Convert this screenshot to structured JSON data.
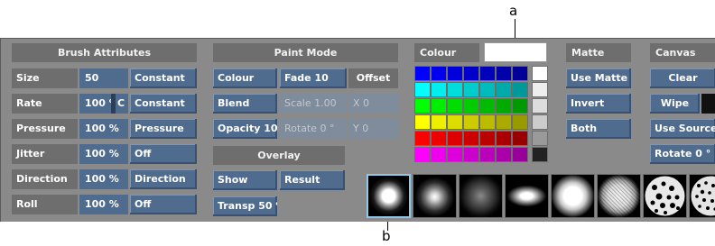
{
  "callouts": {
    "a": "a",
    "b": "b"
  },
  "brush_attributes": {
    "title": "Brush Attributes",
    "rows": [
      {
        "label": "Size",
        "value": "50",
        "mode": "Constant"
      },
      {
        "label": "Rate",
        "value": "100 %",
        "extra": "C",
        "mode": "Constant"
      },
      {
        "label": "Pressure",
        "value": "100 %",
        "mode": "Pressure"
      },
      {
        "label": "Jitter",
        "value": "100 %",
        "mode": "Off"
      },
      {
        "label": "Direction",
        "value": "100 %",
        "mode": "Direction"
      },
      {
        "label": "Roll",
        "value": "100 %",
        "mode": "Off"
      }
    ]
  },
  "paint_mode": {
    "title": "Paint Mode",
    "colour_button": "Colour",
    "fade": "Fade 10",
    "offset": "Offset",
    "blend": "Blend",
    "scale": "Scale 1.00",
    "x": "X 0",
    "opacity": "Opacity 100",
    "rotate": "Rotate 0 °",
    "y": "Y 0"
  },
  "overlay": {
    "title": "Overlay",
    "show": "Show",
    "result": "Result",
    "transp": "Transp 50 %"
  },
  "colour": {
    "title": "Colour",
    "current": "#ffffff",
    "palette": [
      [
        "#0000ff",
        "#0000ee",
        "#0000dd",
        "#0000cc",
        "#0000bb",
        "#0000aa",
        "#000099"
      ],
      [
        "#00ffff",
        "#00eeee",
        "#00dddd",
        "#00cccc",
        "#00bbbb",
        "#00aaaa",
        "#009999"
      ],
      [
        "#00ff00",
        "#00ee00",
        "#00dd00",
        "#00cc00",
        "#00bb00",
        "#00aa00",
        "#009900"
      ],
      [
        "#ffff00",
        "#eeee00",
        "#dddd00",
        "#cccc00",
        "#bbbb00",
        "#aaaa00",
        "#999900"
      ],
      [
        "#ff0000",
        "#ee0000",
        "#dd0000",
        "#cc0000",
        "#bb0000",
        "#aa0000",
        "#990000"
      ],
      [
        "#ff00ff",
        "#ee00ee",
        "#dd00dd",
        "#cc00cc",
        "#bb00bb",
        "#aa00aa",
        "#990099"
      ]
    ],
    "greys": [
      "#ffffff",
      "#eeeeee",
      "#dddddd",
      "#cccccc",
      "#9a9a9a",
      "#222222"
    ]
  },
  "matte": {
    "title": "Matte",
    "use_matte": "Use Matte",
    "invert": "Invert",
    "both": "Both"
  },
  "canvas": {
    "title": "Canvas",
    "clear": "Clear",
    "wipe": "Wipe",
    "use_source": "Use Source",
    "rotate": "Rotate 0 °"
  },
  "brushes": [
    "soft-round-small",
    "soft-airbrush",
    "diffuse-spray",
    "oval-soft",
    "large-soft",
    "noise-splatter",
    "cell-texture",
    "cell-texture-fine"
  ]
}
